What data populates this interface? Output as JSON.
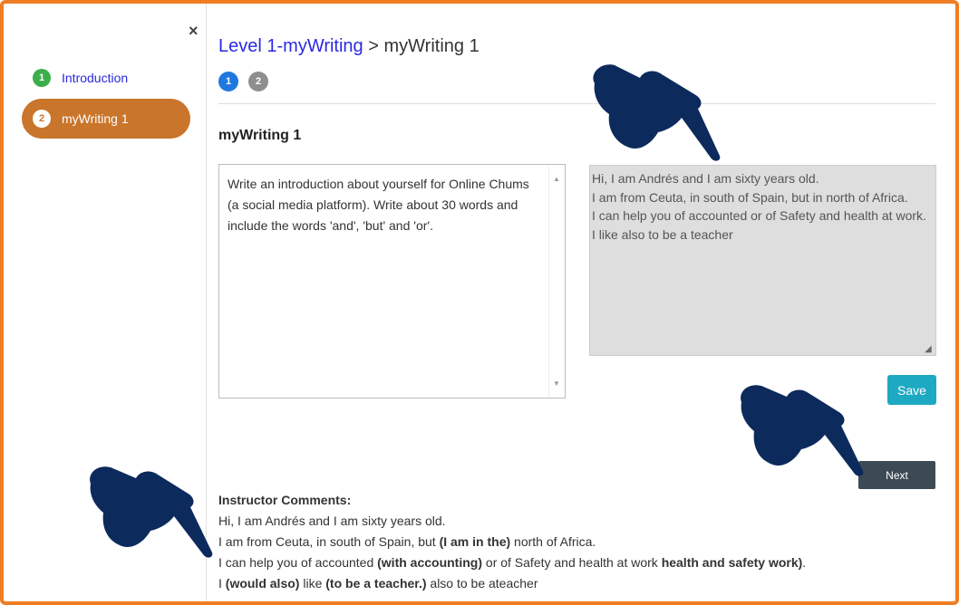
{
  "sidebar": {
    "close": "×",
    "items": [
      {
        "num": "1",
        "label": "Introduction",
        "state": "complete"
      },
      {
        "num": "2",
        "label": "myWriting 1",
        "state": "active"
      }
    ]
  },
  "breadcrumb": {
    "link": "Level 1-myWriting",
    "separator": " > ",
    "current": "myWriting 1"
  },
  "steps": [
    "1",
    "2"
  ],
  "section_title": "myWriting 1",
  "prompt": "Write an introduction about yourself for Online Chums (a social media platform). Write about 30 words and include the words 'and', 'but' and 'or'.",
  "answer": "Hi, I am Andrés and I am sixty years old.\nI am from Ceuta, in south of Spain, but in north of Africa.\nI can help you of accounted or of Safety and health at work.\nI like also to be a teacher",
  "buttons": {
    "save": "Save",
    "next": "Next"
  },
  "comments": {
    "title": "Instructor Comments:",
    "line1": "Hi, I am Andrés and I am sixty years old.",
    "line2_a": "I am from Ceuta, in south of Spain, but ",
    "line2_b": "(I am in the)",
    "line2_c": " north of Africa.",
    "line3_a": "I can help you of accounted ",
    "line3_b": "(with accounting)",
    "line3_c": " or of Safety and health at work ",
    "line3_d": "health and safety work)",
    "line3_e": ".",
    "line4_a": "I ",
    "line4_b": "(would also)",
    "line4_c": " like ",
    "line4_d": "(to be a teacher.)",
    "line4_e": " also to be ateacher"
  },
  "colors": {
    "frame": "#f07d22",
    "active_nav": "#c9752b",
    "link": "#2a2ae0",
    "save": "#1ea9c2",
    "next": "#3c4a53",
    "hand": "#0d2a5c"
  },
  "icons": [
    "close-icon",
    "pointing-hand-icon",
    "resize-grip-icon"
  ]
}
